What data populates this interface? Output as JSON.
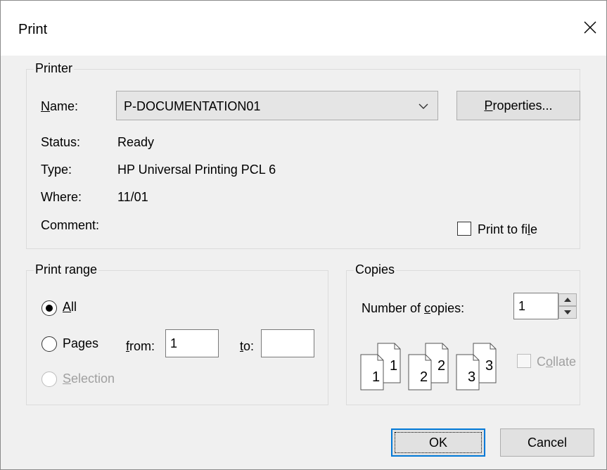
{
  "window": {
    "title": "Print"
  },
  "printer": {
    "group_label": "Printer",
    "name_label": "Name:",
    "name_value": "P-DOCUMENTATION01",
    "properties_label": "Properties...",
    "status_label": "Status:",
    "status_value": "Ready",
    "type_label": "Type:",
    "type_value": "HP Universal Printing PCL 6",
    "where_label": "Where:",
    "where_value": "11/01",
    "comment_label": "Comment:",
    "print_to_file_label": "Print to file",
    "print_to_file_checked": false
  },
  "print_range": {
    "group_label": "Print range",
    "all_label": "All",
    "pages_label": "Pages",
    "from_label": "from:",
    "from_value": "1",
    "to_label": "to:",
    "to_value": "",
    "selection_label": "Selection",
    "selected": "All"
  },
  "copies": {
    "group_label": "Copies",
    "number_label": "Number of copies:",
    "number_value": "1",
    "collate_label": "Collate",
    "collate_checked": false,
    "collate_digits": [
      "1",
      "2",
      "3"
    ]
  },
  "buttons": {
    "ok": "OK",
    "cancel": "Cancel"
  },
  "icons": {
    "close": "close-icon",
    "dropdown": "chevron-down-icon",
    "spin": "spinner-arrows-icon"
  }
}
